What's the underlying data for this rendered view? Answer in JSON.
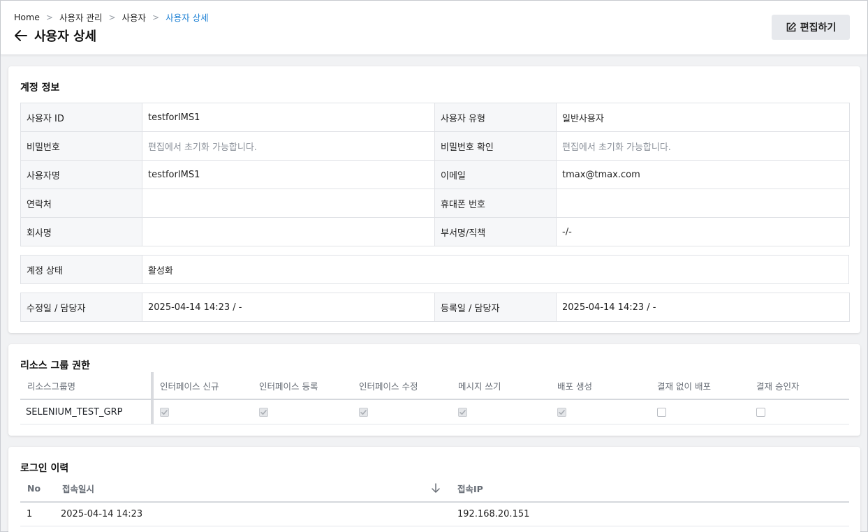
{
  "breadcrumb": [
    "Home",
    "사용자 관리",
    "사용자",
    "사용자 상세"
  ],
  "page_title": "사용자 상세",
  "edit_label": "편집하기",
  "account": {
    "title": "계정 정보",
    "rows": [
      {
        "l1": "사용자 ID",
        "v1": "testforIMS1",
        "l2": "사용자 유형",
        "v2": "일반사용자"
      },
      {
        "l1": "비밀번호",
        "v1": "편집에서 초기화 가능합니다.",
        "l2": "비밀번호 확인",
        "v2": "편집에서 초기화 가능합니다."
      },
      {
        "l1": "사용자명",
        "v1": "testforIMS1",
        "l2": "이메일",
        "v2": "tmax@tmax.com"
      },
      {
        "l1": "연락처",
        "v1": "",
        "l2": "휴대폰 번호",
        "v2": ""
      },
      {
        "l1": "회사명",
        "v1": "",
        "l2": "부서명/직책",
        "v2": "-/-"
      }
    ],
    "status_label": "계정 상태",
    "status_value": "활성화",
    "modified_label": "수정일 / 담당자",
    "modified_value": "2025-04-14 14:23 / -",
    "registered_label": "등록일 / 담당자",
    "registered_value": "2025-04-14 14:23 / -"
  },
  "permissions": {
    "title": "리소스 그룹 권한",
    "group_header": "리소스그룹명",
    "columns": [
      "인터페이스 신규",
      "인터페이스 등록",
      "인터페이스 수정",
      "메시지 쓰기",
      "배포 생성",
      "결재 없이 배포",
      "결재 승인자"
    ],
    "rows": [
      {
        "group": "SELENIUM_TEST_GRP",
        "checks": [
          true,
          true,
          true,
          true,
          true,
          false,
          false
        ]
      }
    ]
  },
  "login_history": {
    "title": "로그인 이력",
    "columns": {
      "no": "No",
      "time": "접속일시",
      "ip": "접속IP"
    },
    "sort_icon": "arrow-down-icon",
    "rows": [
      {
        "no": "1",
        "time": "2025-04-14 14:23",
        "ip": "192.168.20.151"
      }
    ]
  }
}
